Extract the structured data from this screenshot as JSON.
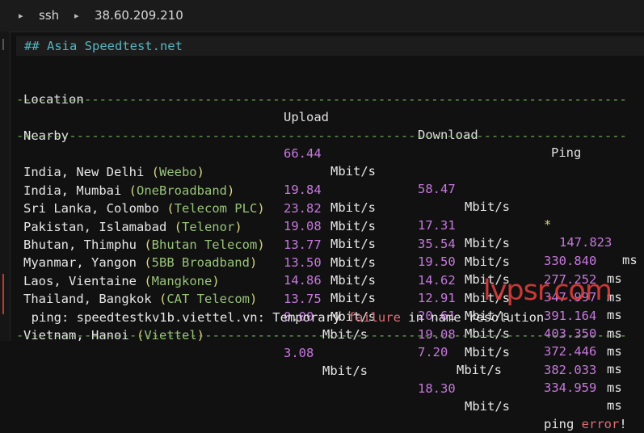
{
  "tab": {
    "chevron": "▸",
    "label1": "ssh",
    "label2": "38.60.209.210"
  },
  "section_title": "## Asia Speedtest.net",
  "headers": {
    "location": "Location",
    "upload": "Upload",
    "download": "Download",
    "ping": "Ping"
  },
  "separator": "---------------------------------------------------------------------------------",
  "nearby": {
    "location": "Nearby",
    "upload": "66.44",
    "upload_unit": "Mbit/s",
    "download": "58.47",
    "download_unit": "Mbit/s",
    "star": "*",
    "ping": "147.823",
    "ping_unit": "ms"
  },
  "rows": [
    {
      "city": "India, New Delhi ",
      "lp": "(",
      "isp": "Weebo",
      "rp": ")",
      "upload": "19.84",
      "download": "17.31",
      "ping": "330.840"
    },
    {
      "city": "India, Mumbai ",
      "lp": "(",
      "isp": "OneBroadband",
      "rp": ")",
      "upload": "23.82",
      "download": "35.54",
      "ping": "277.252"
    },
    {
      "city": "Sri Lanka, Colombo ",
      "lp": "(",
      "isp": "Telecom PLC",
      "rp": ")",
      "upload": "19.08",
      "download": "19.50",
      "ping": "347.997"
    },
    {
      "city": "Pakistan, Islamabad ",
      "lp": "(",
      "isp": "Telenor",
      "rp": ")",
      "upload": "13.77",
      "download": "14.62",
      "ping": "391.164"
    },
    {
      "city": "Bhutan, Thimphu ",
      "lp": "(",
      "isp": "Bhutan Telecom",
      "rp": ")",
      "upload": "13.50",
      "download": "12.91",
      "ping": "403.350"
    },
    {
      "city": "Myanmar, Yangon ",
      "lp": "(",
      "isp": "5BB Broadband",
      "rp": ")",
      "upload": "14.86",
      "download": "20.61",
      "ping": "372.446"
    },
    {
      "city": "Laos, Vientaine ",
      "lp": "(",
      "isp": "Mangkone",
      "rp": ")",
      "upload": "13.75",
      "download": "19.08",
      "ping": "382.033"
    },
    {
      "city": "Thailand, Bangkok ",
      "lp": "(",
      "isp": "CAT Telecom",
      "rp": ")",
      "upload": "0.00",
      "download": "7.20",
      "ping": "334.959"
    }
  ],
  "unit_mbit": "Mbit/s",
  "unit_ms": "ms",
  "error_line": {
    "prefix": "ping: speedtestkv1b.viettel.vn: Temporary ",
    "failure": "failure",
    "suffix": " in name resolution"
  },
  "vietnam": {
    "city": "Vietnam, Hanoi ",
    "lp": "(",
    "isp": "Viettel",
    "rp": ")",
    "upload": "3.08",
    "download": "18.30",
    "ping_word": "ping ",
    "error_word": "error",
    "bang": "!"
  },
  "watermark": "lvpsr.com"
}
